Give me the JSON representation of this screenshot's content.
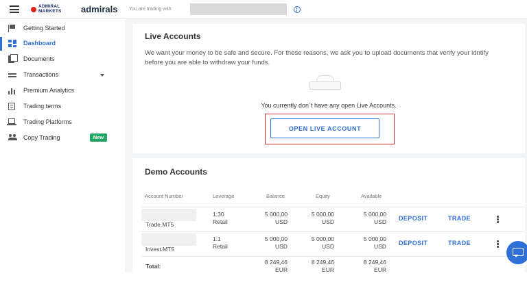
{
  "header": {
    "logo_text": "ADMIRAL MARKETS",
    "brand": "admirals",
    "trading_with_label": "You are trading with"
  },
  "sidebar": {
    "items": [
      {
        "label": "Getting Started",
        "icon": "flag-icon"
      },
      {
        "label": "Dashboard",
        "icon": "dashboard-icon",
        "active": true
      },
      {
        "label": "Documents",
        "icon": "documents-icon"
      },
      {
        "label": "Transactions",
        "icon": "transactions-icon",
        "expandable": true
      },
      {
        "label": "Premium Analytics",
        "icon": "bar-chart-icon"
      },
      {
        "label": "Trading terms",
        "icon": "terms-icon"
      },
      {
        "label": "Trading Platforms",
        "icon": "laptop-icon"
      },
      {
        "label": "Copy Trading",
        "icon": "people-icon",
        "badge": "New"
      }
    ]
  },
  "live": {
    "title": "Live Accounts",
    "description": "We want your money to be safe and secure. For these reasons, we ask you to upload documents that verify your idntify before you are able to withdraw your funds.",
    "empty_message": "You currently don´t have any open Live Accounts.",
    "open_button": "OPEN LIVE ACCOUNT"
  },
  "demo": {
    "title": "Demo Accounts",
    "columns": [
      "Account Number",
      "Leverage",
      "Balance",
      "Equity",
      "Available"
    ],
    "rows": [
      {
        "account": "Trade.MT5",
        "leverage": "1:30",
        "leverage_type": "Retail",
        "balance": "5 000,00",
        "equity": "5 000,00",
        "available": "5 000,00",
        "currency": "USD",
        "deposit": "DEPOSIT",
        "trade": "TRADE"
      },
      {
        "account": "Invest.MT5",
        "leverage": "1:1",
        "leverage_type": "Retail",
        "balance": "5 000,00",
        "equity": "5 000,00",
        "available": "5 000,00",
        "currency": "USD",
        "deposit": "DEPOSIT",
        "trade": "TRADE"
      }
    ],
    "total": {
      "label": "Total:",
      "balance": "8 249,46",
      "equity": "8 249,46",
      "available": "8 249,46",
      "currency": "EUR"
    }
  },
  "colors": {
    "accent": "#2f6fd8",
    "highlight": "#d32f2f",
    "badge": "#1fa463"
  }
}
